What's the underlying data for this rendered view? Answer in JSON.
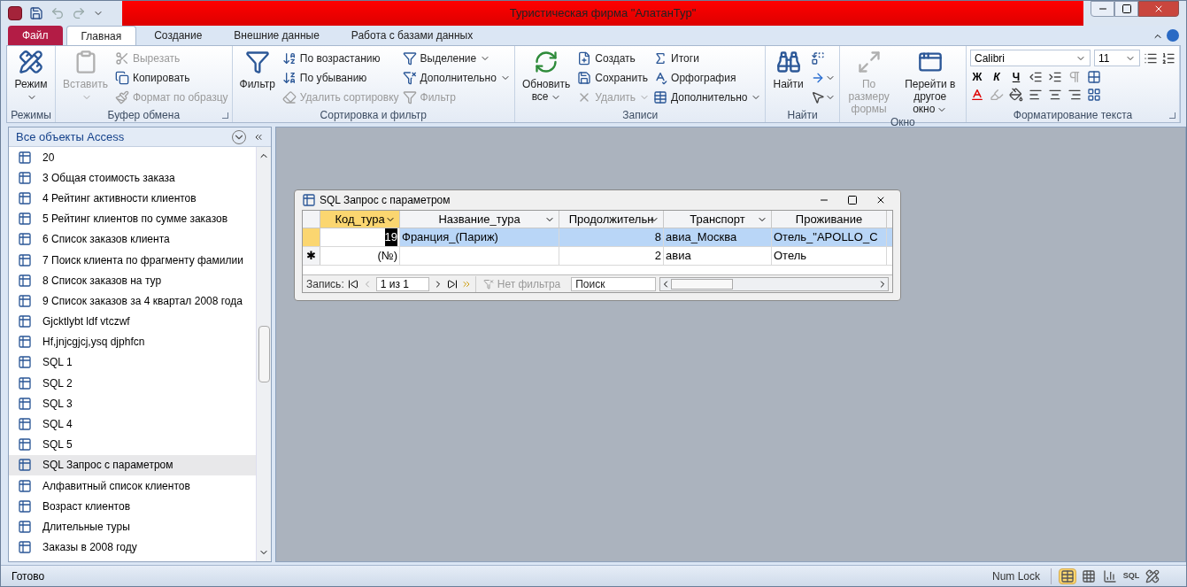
{
  "window": {
    "title": "Туристическая фирма \"АлатанТур\""
  },
  "ribbon_tabs": [
    {
      "label": "Файл",
      "kind": "file",
      "selected": false
    },
    {
      "label": "Главная",
      "kind": "tab",
      "selected": true
    },
    {
      "label": "Создание",
      "kind": "tab",
      "selected": false
    },
    {
      "label": "Внешние данные",
      "kind": "tab",
      "selected": false
    },
    {
      "label": "Работа с базами данных",
      "kind": "tab",
      "selected": false
    }
  ],
  "ribbon_groups": [
    {
      "label": "Режимы",
      "kind": "plain",
      "launcher": false,
      "blocks": [
        {
          "kind": "large",
          "items": [
            {
              "label": "Режим",
              "disabled": false,
              "dropdown": true
            }
          ]
        }
      ]
    },
    {
      "label": "Буфер обмена",
      "kind": "plain",
      "launcher": true,
      "blocks": [
        {
          "kind": "large",
          "items": [
            {
              "label": "Вставить",
              "disabled": true,
              "dropdown": true
            }
          ]
        },
        {
          "kind": "stack",
          "items": [
            {
              "label": "Вырезать",
              "disabled": true,
              "dropdown": false
            },
            {
              "label": "Копировать",
              "disabled": false,
              "dropdown": false
            },
            {
              "label": "Формат по образцу",
              "disabled": true,
              "dropdown": false
            }
          ]
        }
      ]
    },
    {
      "label": "Сортировка и фильтр",
      "kind": "plain",
      "launcher": false,
      "blocks": [
        {
          "kind": "large",
          "items": [
            {
              "label": "Фильтр",
              "disabled": false,
              "dropdown": false
            }
          ]
        },
        {
          "kind": "stack",
          "items": [
            {
              "label": "По возрастанию",
              "disabled": false,
              "dropdown": false
            },
            {
              "label": "По убыванию",
              "disabled": false,
              "dropdown": false
            },
            {
              "label": "Удалить сортировку",
              "disabled": true,
              "dropdown": false
            }
          ]
        },
        {
          "kind": "stack",
          "items": [
            {
              "label": "Выделение",
              "disabled": false,
              "dropdown": true
            },
            {
              "label": "Дополнительно",
              "disabled": false,
              "dropdown": true
            },
            {
              "label": "Фильтр",
              "disabled": true,
              "dropdown": false
            }
          ]
        }
      ]
    },
    {
      "label": "Записи",
      "kind": "plain",
      "launcher": false,
      "blocks": [
        {
          "kind": "large",
          "items": [
            {
              "label": "Обновить все",
              "disabled": false,
              "dropdown": true
            }
          ]
        },
        {
          "kind": "stack",
          "items": [
            {
              "label": "Создать",
              "disabled": false,
              "dropdown": false
            },
            {
              "label": "Сохранить",
              "disabled": false,
              "dropdown": false
            },
            {
              "label": "Удалить",
              "disabled": true,
              "dropdown": true
            }
          ]
        },
        {
          "kind": "stack",
          "items": [
            {
              "label": "Итоги",
              "disabled": false,
              "dropdown": false
            },
            {
              "label": "Орфография",
              "disabled": false,
              "dropdown": false
            },
            {
              "label": "Дополнительно",
              "disabled": false,
              "dropdown": true
            }
          ]
        }
      ]
    },
    {
      "label": "Найти",
      "kind": "plain",
      "launcher": false,
      "blocks": [
        {
          "kind": "large",
          "items": [
            {
              "label": "Найти",
              "disabled": false,
              "dropdown": false
            }
          ]
        }
      ]
    },
    {
      "label": "Окно",
      "kind": "plain",
      "launcher": false,
      "blocks": [
        {
          "kind": "large",
          "items": [
            {
              "label": "По размеру формы",
              "disabled": true,
              "dropdown": false
            }
          ]
        },
        {
          "kind": "large",
          "items": [
            {
              "label": "Перейти в другое окно",
              "disabled": false,
              "dropdown": true
            }
          ]
        }
      ]
    },
    {
      "label": "Форматирование текста",
      "kind": "format",
      "launcher": true,
      "font": "Calibri",
      "size": "11",
      "bold": "Ж",
      "italic": "К",
      "underline": "Ч"
    }
  ],
  "nav_pane": {
    "title": "Все объекты Access",
    "items": [
      {
        "label": "20",
        "selected": false
      },
      {
        "label": "3 Общая стоимость заказа",
        "selected": false
      },
      {
        "label": "4 Рейтинг активности клиентов",
        "selected": false
      },
      {
        "label": "5 Рейтинг клиентов по сумме заказов",
        "selected": false
      },
      {
        "label": "6 Список заказов клиента",
        "selected": false
      },
      {
        "label": "7 Поиск клиента по фрагменту фамилии",
        "selected": false
      },
      {
        "label": "8 Список заказов на тур",
        "selected": false
      },
      {
        "label": "9 Список заказов за 4 квартал 2008 года",
        "selected": false
      },
      {
        "label": "Gjcktlybt ldf vtczwf",
        "selected": false
      },
      {
        "label": "Hf,jnjcgjcj,ysq djphfcn",
        "selected": false
      },
      {
        "label": "SQL 1",
        "selected": false
      },
      {
        "label": "SQL 2",
        "selected": false
      },
      {
        "label": "SQL 3",
        "selected": false
      },
      {
        "label": "SQL 4",
        "selected": false
      },
      {
        "label": "SQL 5",
        "selected": false
      },
      {
        "label": "SQL Запрос с параметром",
        "selected": true
      },
      {
        "label": "Алфавитный список клиентов",
        "selected": false
      },
      {
        "label": "Возраст клиентов",
        "selected": false
      },
      {
        "label": "Длительные туры",
        "selected": false
      },
      {
        "label": "Заказы в 2008 году",
        "selected": false
      }
    ]
  },
  "query_window": {
    "title": "SQL Запрос с параметром",
    "columns": [
      {
        "label": "Код_тура",
        "selected": true,
        "kind": "number"
      },
      {
        "label": "Название_тура",
        "selected": false,
        "kind": "text"
      },
      {
        "label": "Продолжительн",
        "selected": false,
        "kind": "number"
      },
      {
        "label": "Транспорт",
        "selected": false,
        "kind": "text"
      },
      {
        "label": "Проживание",
        "selected": false,
        "kind": "text"
      }
    ],
    "rows": [
      {
        "kind": "record",
        "selected": true,
        "cells": [
          "19",
          "Франция_(Париж)",
          "8",
          "авиа_Москва",
          "Отель_\"APOLLO_C"
        ]
      },
      {
        "kind": "new",
        "selected": false,
        "marker": "✱",
        "cells": [
          "(№)",
          null,
          "2",
          "авиа",
          "Отель"
        ]
      }
    ],
    "record_nav": {
      "label": "Запись:",
      "position": "1 из 1",
      "filter": "Нет фильтра",
      "search_placeholder": "Поиск"
    }
  },
  "status_bar": {
    "text": "Готово",
    "num_lock": "Num Lock",
    "views": [
      {
        "kind": "datasheet",
        "selected": true
      },
      {
        "kind": "pivot_table",
        "selected": false
      },
      {
        "kind": "pivot_chart",
        "selected": false
      },
      {
        "kind": "sql",
        "label": "SQL",
        "selected": false
      },
      {
        "kind": "design",
        "selected": false
      }
    ]
  }
}
